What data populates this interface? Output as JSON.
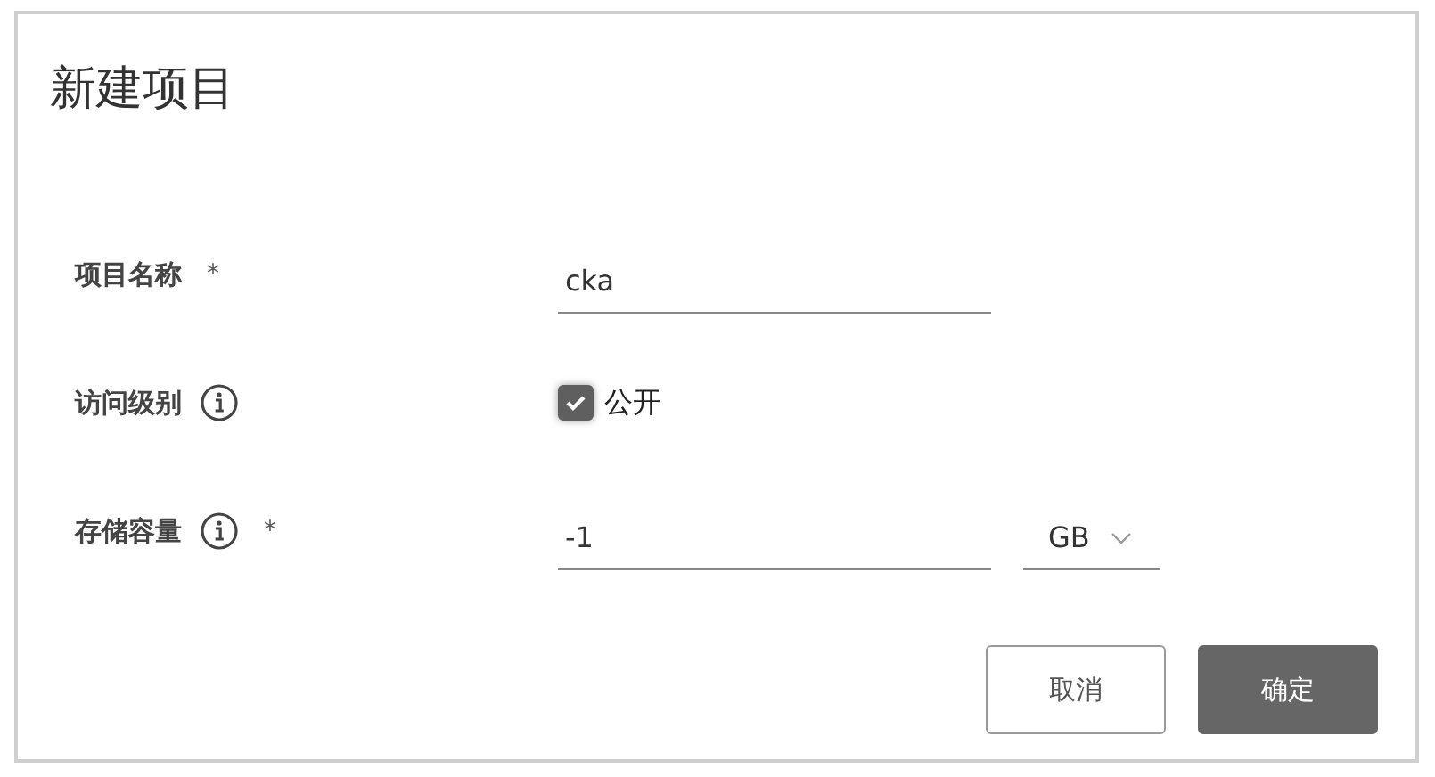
{
  "dialog": {
    "title": "新建项目"
  },
  "fields": [
    {
      "kind": "text",
      "label": "项目名称",
      "info": false,
      "required": true,
      "value": "cka"
    },
    {
      "kind": "checkbox",
      "label": "访问级别",
      "info": true,
      "required": false,
      "checked": true,
      "option": "公开"
    },
    {
      "kind": "quota",
      "label": "存储容量",
      "info": true,
      "required": true,
      "value": "-1",
      "unit": "GB"
    }
  ],
  "required_mark": "*",
  "buttons": [
    {
      "label": "取消",
      "kind": "secondary"
    },
    {
      "label": "确定",
      "kind": "primary"
    }
  ]
}
